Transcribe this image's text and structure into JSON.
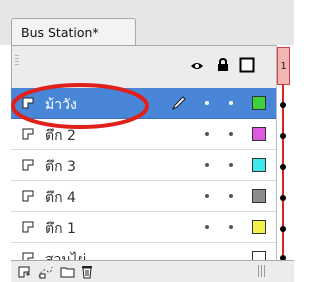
{
  "panel": {
    "tab_title": "Bus Station*"
  },
  "header": {
    "icons": [
      "eye-icon",
      "lock-icon",
      "outline-icon"
    ],
    "frame_number": "1"
  },
  "layers": [
    {
      "name": "ม้าวัง",
      "selected": true,
      "swatch": "#3cd13c"
    },
    {
      "name": "ตึก 2",
      "selected": false,
      "swatch": "#e05ae0"
    },
    {
      "name": "ตึก 3",
      "selected": false,
      "swatch": "#3fe8ea"
    },
    {
      "name": "ตึก 4",
      "selected": false,
      "swatch": "#8c8c8c"
    },
    {
      "name": "ตึก 1",
      "selected": false,
      "swatch": "#f4f04a"
    },
    {
      "name": "สวนไผ่",
      "selected": false,
      "swatch": "#ffffff"
    }
  ],
  "footer": {
    "icons": [
      "new-layer-icon",
      "motion-guide-icon",
      "new-folder-icon",
      "delete-layer-icon"
    ]
  },
  "annotation": {
    "color": "#e0201a"
  }
}
